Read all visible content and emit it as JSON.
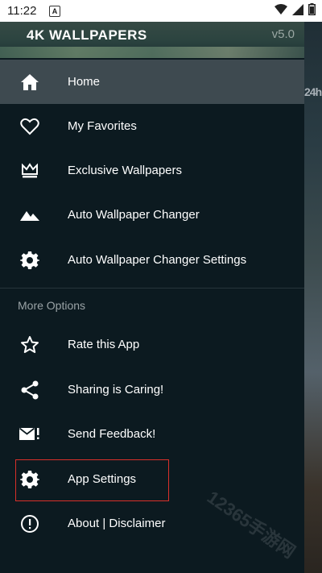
{
  "status_bar": {
    "time": "11:22",
    "notification_letter": "A"
  },
  "header": {
    "title": "4K WALLPAPERS",
    "version": "v5.0"
  },
  "menu": {
    "items": [
      {
        "label": "Home",
        "icon": "home-icon",
        "active": true
      },
      {
        "label": "My Favorites",
        "icon": "heart-icon"
      },
      {
        "label": "Exclusive Wallpapers",
        "icon": "crown-icon"
      },
      {
        "label": "Auto Wallpaper Changer",
        "icon": "mountain-icon"
      },
      {
        "label": "Auto Wallpaper Changer Settings",
        "icon": "gear-icon"
      }
    ],
    "section_title": "More Options",
    "more_items": [
      {
        "label": "Rate this App",
        "icon": "star-icon"
      },
      {
        "label": "Sharing is Caring!",
        "icon": "share-icon"
      },
      {
        "label": "Send Feedback!",
        "icon": "mail-icon"
      },
      {
        "label": "App Settings",
        "icon": "gear-icon",
        "highlighted": true
      },
      {
        "label": "About | Disclaimer",
        "icon": "info-icon"
      }
    ]
  },
  "background_text": "24h",
  "watermark": "12365手游网",
  "colors": {
    "drawer_bg": "#0c1a20",
    "active_bg": "#3e4a50",
    "highlight_border": "#d9302a"
  }
}
